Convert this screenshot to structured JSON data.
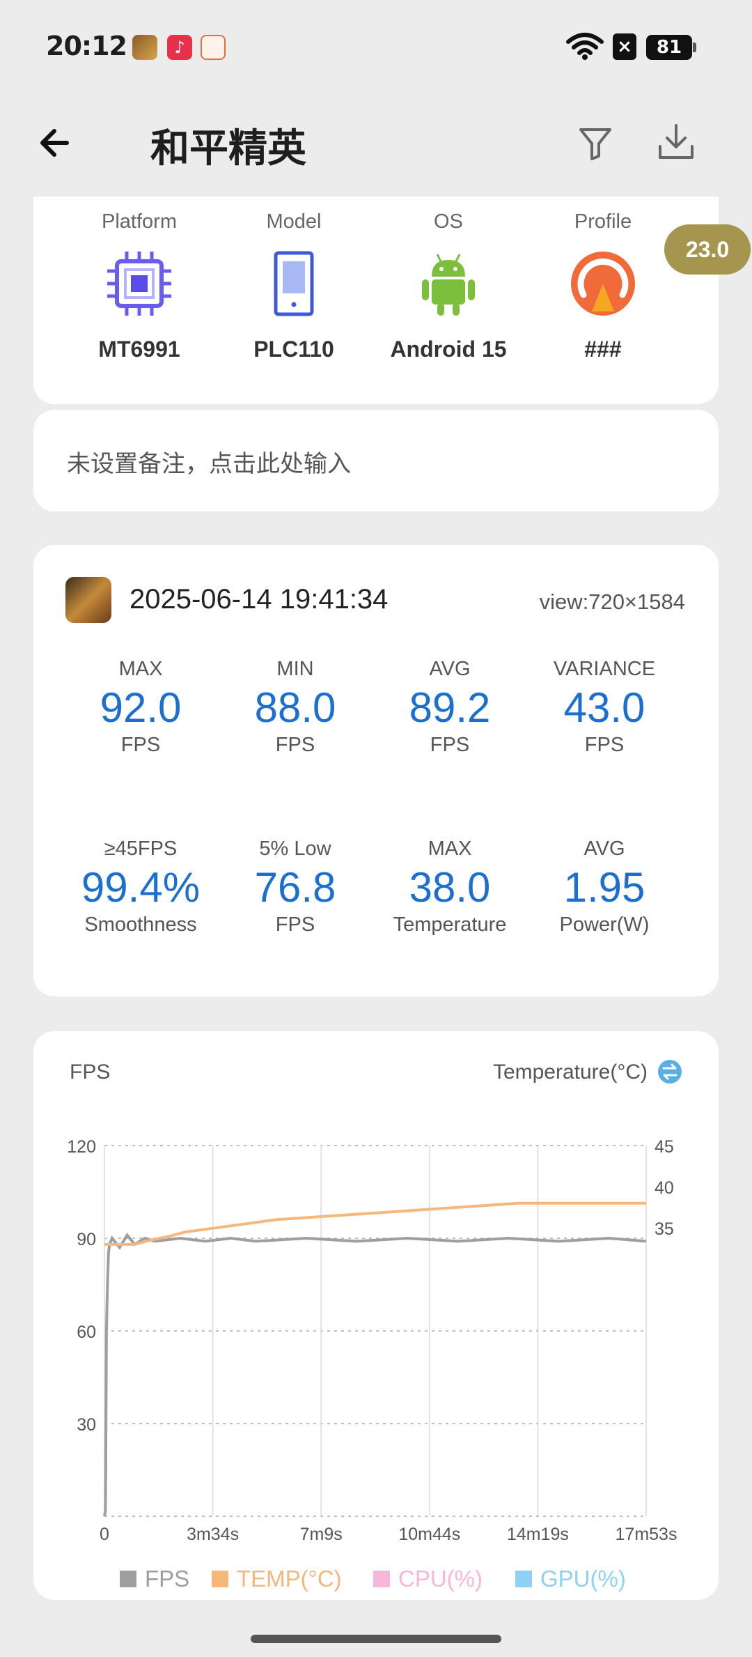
{
  "status_bar": {
    "time": "20:12",
    "battery": "81",
    "notification_icons": [
      "game-app-icon",
      "music-app-icon",
      "game-center-icon"
    ]
  },
  "app_bar": {
    "title": "和平精英",
    "back_icon": "back-arrow-icon",
    "filter_icon": "filter-icon",
    "download_icon": "download-icon"
  },
  "device": {
    "items": [
      {
        "label": "Platform",
        "value": "MT6991",
        "icon": "chip-icon"
      },
      {
        "label": "Model",
        "value": "PLC110",
        "icon": "phone-icon"
      },
      {
        "label": "OS",
        "value": "Android 15",
        "icon": "android-icon"
      },
      {
        "label": "Profile",
        "value": "###",
        "icon": "profile-gauge-icon"
      }
    ],
    "floating_badge": "23.0"
  },
  "note": {
    "placeholder_text": "未设置备注，点击此处输入"
  },
  "session": {
    "timestamp": "2025-06-14 19:41:34",
    "view": "view:720×1584",
    "stats_row1": [
      {
        "label": "MAX",
        "value": "92.0",
        "unit": "FPS"
      },
      {
        "label": "MIN",
        "value": "88.0",
        "unit": "FPS"
      },
      {
        "label": "AVG",
        "value": "89.2",
        "unit": "FPS"
      },
      {
        "label": "VARIANCE",
        "value": "43.0",
        "unit": "FPS"
      }
    ],
    "stats_row2": [
      {
        "label": "≥45FPS",
        "value": "99.4%",
        "unit": "Smoothness"
      },
      {
        "label": "5% Low",
        "value": "76.8",
        "unit": "FPS"
      },
      {
        "label": "MAX",
        "value": "38.0",
        "unit": "Temperature"
      },
      {
        "label": "AVG",
        "value": "1.95",
        "unit": "Power(W)"
      }
    ]
  },
  "colors": {
    "accent_blue": "#1a6fd0",
    "fps_series": "#9e9e9e",
    "temp_series": "#f5b77a",
    "cpu_series": "#f7b6dc",
    "gpu_series": "#8fd0f5",
    "badge": "#a5954e"
  },
  "chart_data": {
    "type": "line",
    "left_axis_title": "FPS",
    "right_axis_title": "Temperature(°C)",
    "swap_icon": "swap-icon",
    "ylim_left": [
      0,
      120
    ],
    "yticks_left": [
      "120",
      "90",
      "60",
      "30"
    ],
    "ylim_right": [
      0,
      45
    ],
    "yticks_right": [
      "45",
      "40",
      "35"
    ],
    "xlim_seconds": [
      0,
      1073
    ],
    "xticks": [
      "0",
      "3m34s",
      "7m9s",
      "10m44s",
      "14m19s",
      "17m53s"
    ],
    "grid": true,
    "legend_position": "bottom",
    "legend": [
      "FPS",
      "TEMP(°C)",
      "CPU(%)",
      "GPU(%)"
    ],
    "series": [
      {
        "name": "FPS",
        "x": [
          0,
          2,
          4,
          6,
          8,
          10,
          15,
          20,
          30,
          45,
          60,
          80,
          100,
          150,
          200,
          250,
          300,
          400,
          500,
          600,
          700,
          800,
          900,
          1000,
          1073
        ],
        "values": [
          0,
          2,
          60,
          76,
          85,
          88,
          90,
          89,
          87,
          91,
          88,
          90,
          89,
          90,
          89,
          90,
          89,
          90,
          89,
          90,
          89,
          90,
          89,
          90,
          89
        ]
      },
      {
        "name": "TEMP(°C)",
        "x": [
          0,
          60,
          90,
          130,
          160,
          220,
          340,
          580,
          820,
          1020,
          1073
        ],
        "values": [
          33,
          33,
          33.5,
          34,
          34.5,
          35,
          36,
          37,
          38,
          38,
          38
        ]
      }
    ]
  }
}
